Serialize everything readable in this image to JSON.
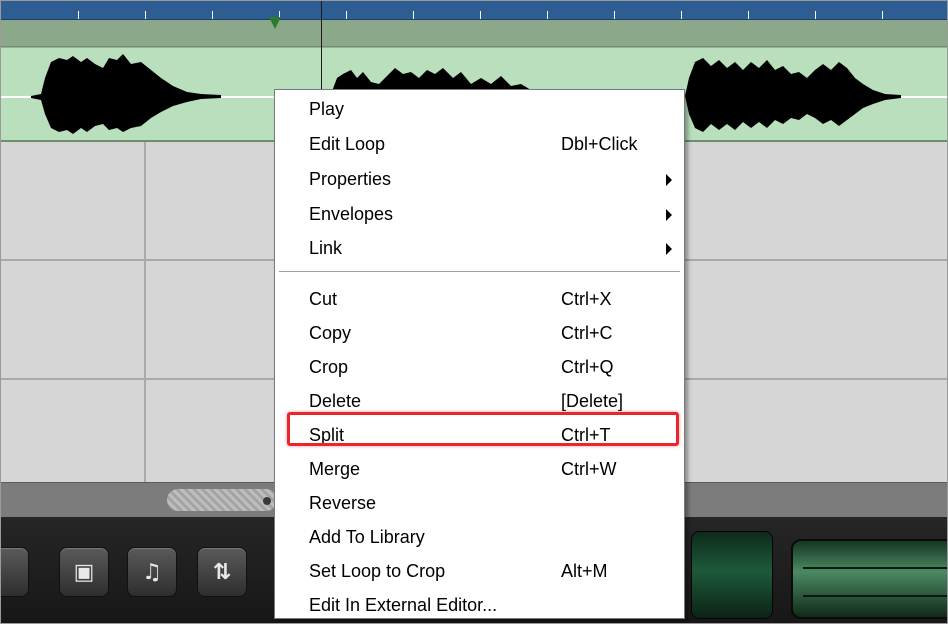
{
  "menu": {
    "items": [
      {
        "label": "Play",
        "shortcut": ""
      },
      {
        "label": "Edit Loop",
        "shortcut": "Dbl+Click"
      },
      {
        "label": "Properties",
        "shortcut": ""
      },
      {
        "label": "Envelopes",
        "shortcut": ""
      },
      {
        "label": "Link",
        "shortcut": ""
      },
      {
        "label": "Cut",
        "shortcut": "Ctrl+X"
      },
      {
        "label": "Copy",
        "shortcut": "Ctrl+C"
      },
      {
        "label": "Crop",
        "shortcut": "Ctrl+Q"
      },
      {
        "label": "Delete",
        "shortcut": "[Delete]"
      },
      {
        "label": "Split",
        "shortcut": "Ctrl+T"
      },
      {
        "label": "Merge",
        "shortcut": "Ctrl+W"
      },
      {
        "label": "Reverse",
        "shortcut": ""
      },
      {
        "label": "Add To Library",
        "shortcut": ""
      },
      {
        "label": "Set Loop to Crop",
        "shortcut": "Alt+M"
      },
      {
        "label": "Edit In External Editor...",
        "shortcut": ""
      }
    ],
    "submenu_items": [
      "Properties",
      "Envelopes",
      "Link"
    ],
    "highlighted_item": "Split"
  },
  "colors": {
    "ruler": "#2d5d93",
    "clip": "#b9dfbd",
    "highlight": "#e8262b",
    "menu_background": "#ffffff"
  },
  "transport": {
    "buttons": [
      {
        "icon": "loop-icon"
      },
      {
        "icon": "metronome-icon"
      },
      {
        "icon": "import-export-icon"
      }
    ]
  }
}
